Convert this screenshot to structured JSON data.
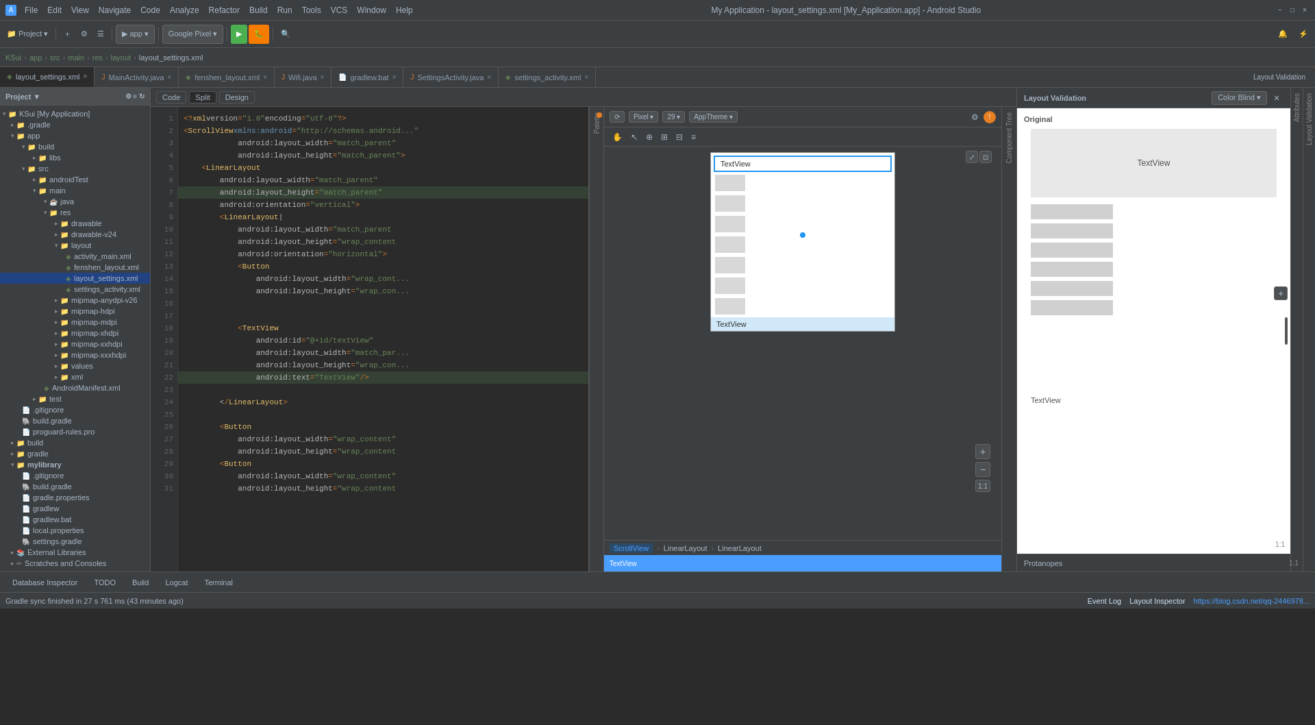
{
  "title_bar": {
    "title": "My Application - layout_settings.xml [My_Application.app] - Android Studio",
    "app_name": "KSui",
    "menus": [
      "File",
      "Edit",
      "View",
      "Navigate",
      "Code",
      "Analyze",
      "Refactor",
      "Build",
      "Run",
      "Tools",
      "VCS",
      "Window",
      "Help"
    ]
  },
  "nav_bar": {
    "items": [
      "KSui",
      "app",
      "src",
      "main",
      "res",
      "layout",
      "layout_settings.xml"
    ]
  },
  "tabs": [
    {
      "label": "layout_settings.xml",
      "active": true,
      "icon": "xml"
    },
    {
      "label": "MainActivity.java",
      "active": false,
      "icon": "java"
    },
    {
      "label": "fenshen_layout.xml",
      "active": false,
      "icon": "xml"
    },
    {
      "label": "Wifi.java",
      "active": false,
      "icon": "java"
    },
    {
      "label": "gradlew.bat",
      "active": false,
      "icon": "bat"
    },
    {
      "label": "SettingsActivity.java",
      "active": false,
      "icon": "java"
    },
    {
      "label": "settings_activity.xml",
      "active": false,
      "icon": "xml"
    }
  ],
  "toolbar": {
    "module_selector": "app",
    "device_selector": "Google Pixel",
    "run_label": "▶",
    "debug_label": "🐛"
  },
  "code_toolbar": {
    "code_label": "Code",
    "split_label": "Split",
    "design_label": "Design"
  },
  "code_lines": [
    {
      "num": 1,
      "text": "<?xml version=\"1.0\" encoding=\"utf-8\"?>"
    },
    {
      "num": 2,
      "text": "<ScrollView xmlns:android=\"http://schemas.android...\""
    },
    {
      "num": 3,
      "text": "            android:layout_width=\"match_parent\""
    },
    {
      "num": 4,
      "text": "            android:layout_height=\"match_parent\">"
    },
    {
      "num": 5,
      "text": "    <LinearLayout"
    },
    {
      "num": 6,
      "text": "        android:layout_width=\"match_parent\""
    },
    {
      "num": 7,
      "text": "        android:layout_height=\"match_parent\""
    },
    {
      "num": 8,
      "text": "        android:orientation=\"vertical\">"
    },
    {
      "num": 9,
      "text": "        <LinearLayout"
    },
    {
      "num": 10,
      "text": "            android:layout_width=\"match_parent\""
    },
    {
      "num": 11,
      "text": "            android:layout_height=\"wrap_content\""
    },
    {
      "num": 12,
      "text": "            android:orientation=\"horizontal\">"
    },
    {
      "num": 13,
      "text": "            <Button"
    },
    {
      "num": 14,
      "text": "                android:layout_width=\"wrap_cont..."
    },
    {
      "num": 15,
      "text": "                android:layout_height=\"wrap_con..."
    },
    {
      "num": 16,
      "text": ""
    },
    {
      "num": 17,
      "text": ""
    },
    {
      "num": 18,
      "text": "            <TextView"
    },
    {
      "num": 19,
      "text": "                android:id=\"@+id/textView\""
    },
    {
      "num": 20,
      "text": "                android:layout_width=\"match_par..."
    },
    {
      "num": 21,
      "text": "                android:layout_height=\"wrap_con..."
    },
    {
      "num": 22,
      "text": "                android:text=\"TextView\" />"
    },
    {
      "num": 23,
      "text": ""
    },
    {
      "num": 24,
      "text": "        <Button"
    },
    {
      "num": 25,
      "text": "            android:layout_width=\"wrap_content\""
    },
    {
      "num": 26,
      "text": "            android:layout_height=\"wrap_content"
    },
    {
      "num": 27,
      "text": "        <Button"
    },
    {
      "num": 28,
      "text": "            android:layout_width=\"wrap_content\""
    },
    {
      "num": 29,
      "text": "            android:layout_height=\"wrap_content"
    },
    {
      "num": 30,
      "text": "        <Button"
    },
    {
      "num": 31,
      "text": "            android:layout_width=\"wrap_cont..."
    }
  ],
  "file_tree": {
    "items": [
      {
        "label": "My Application",
        "type": "project",
        "indent": 0,
        "expanded": true
      },
      {
        "label": ".gradle",
        "type": "folder",
        "indent": 1,
        "expanded": false
      },
      {
        "label": "app",
        "type": "folder",
        "indent": 1,
        "expanded": true
      },
      {
        "label": "build",
        "type": "folder",
        "indent": 2,
        "expanded": true
      },
      {
        "label": "libs",
        "type": "folder",
        "indent": 3,
        "expanded": false
      },
      {
        "label": "src",
        "type": "folder",
        "indent": 2,
        "expanded": true
      },
      {
        "label": "androidTest",
        "type": "folder",
        "indent": 3,
        "expanded": false
      },
      {
        "label": "main",
        "type": "folder",
        "indent": 3,
        "expanded": true
      },
      {
        "label": "java",
        "type": "folder",
        "indent": 4,
        "expanded": true
      },
      {
        "label": "res",
        "type": "folder",
        "indent": 4,
        "expanded": true
      },
      {
        "label": "drawable",
        "type": "folder",
        "indent": 5,
        "expanded": false
      },
      {
        "label": "drawable-v24",
        "type": "folder",
        "indent": 5,
        "expanded": false
      },
      {
        "label": "layout",
        "type": "folder",
        "indent": 5,
        "expanded": true
      },
      {
        "label": "activity_main.xml",
        "type": "xml",
        "indent": 6
      },
      {
        "label": "fenshen_layout.xml",
        "type": "xml",
        "indent": 6
      },
      {
        "label": "layout_settings.xml",
        "type": "xml",
        "indent": 6,
        "selected": true
      },
      {
        "label": "settings_activity.xml",
        "type": "xml",
        "indent": 6
      },
      {
        "label": "mipmap-anydpi-v26",
        "type": "folder",
        "indent": 5,
        "expanded": false
      },
      {
        "label": "mipmap-hdpi",
        "type": "folder",
        "indent": 5,
        "expanded": false
      },
      {
        "label": "mipmap-mdpi",
        "type": "folder",
        "indent": 5,
        "expanded": false
      },
      {
        "label": "mipmap-xhdpi",
        "type": "folder",
        "indent": 5,
        "expanded": false
      },
      {
        "label": "mipmap-xxhdpi",
        "type": "folder",
        "indent": 5,
        "expanded": false
      },
      {
        "label": "mipmap-xxxhdpi",
        "type": "folder",
        "indent": 5,
        "expanded": false
      },
      {
        "label": "values",
        "type": "folder",
        "indent": 5,
        "expanded": false
      },
      {
        "label": "xml",
        "type": "folder",
        "indent": 5,
        "expanded": false
      },
      {
        "label": "AndroidManifest.xml",
        "type": "xml",
        "indent": 4
      },
      {
        "label": "test",
        "type": "folder",
        "indent": 3,
        "expanded": false
      },
      {
        "label": ".gitignore",
        "type": "file",
        "indent": 2
      },
      {
        "label": "build.gradle",
        "type": "gradle",
        "indent": 2
      },
      {
        "label": "proguard-rules.pro",
        "type": "file",
        "indent": 2
      },
      {
        "label": "build",
        "type": "folder",
        "indent": 1,
        "expanded": false
      },
      {
        "label": "gradle",
        "type": "folder",
        "indent": 1,
        "expanded": false
      },
      {
        "label": "mylibrary",
        "type": "folder",
        "indent": 1,
        "expanded": true,
        "bold": true
      },
      {
        "label": ".gitignore",
        "type": "file",
        "indent": 2
      },
      {
        "label": "build.gradle",
        "type": "gradle",
        "indent": 2
      },
      {
        "label": "gradle.properties",
        "type": "props",
        "indent": 2
      },
      {
        "label": "gradlew",
        "type": "file",
        "indent": 2
      },
      {
        "label": "gradlew.bat",
        "type": "file",
        "indent": 2
      },
      {
        "label": "local.properties",
        "type": "props",
        "indent": 2
      },
      {
        "label": "settings.gradle",
        "type": "gradle",
        "indent": 2
      },
      {
        "label": "External Libraries",
        "type": "folder",
        "indent": 1,
        "expanded": false
      },
      {
        "label": "Scratches and Consoles",
        "type": "folder",
        "indent": 1,
        "expanded": false
      }
    ]
  },
  "preview": {
    "selected_widget": "TextView",
    "bottom_caption": "TextView",
    "breadcrumb": [
      "ScrollView",
      "LinearLayout",
      "LinearLayout"
    ]
  },
  "right_panel": {
    "title": "Layout Validation",
    "original_label": "Original",
    "textview_label": "TextView",
    "textview_bottom": "TextView",
    "protanopes_label": "Protanopes",
    "color_blind_selector": "Color Blind"
  },
  "bottom_status": {
    "message": "Gradle sync finished in 27 s 761 ms (43 minutes ago)",
    "right": {
      "event_log": "Event Log",
      "layout_inspector": "Layout Inspector",
      "url": "https://blog.csdn.net/qq-2446978..."
    }
  },
  "tool_windows": [
    {
      "label": "Database Inspector"
    },
    {
      "label": "TODO"
    },
    {
      "label": "Build"
    },
    {
      "label": "Logcat"
    },
    {
      "label": "Terminal"
    }
  ],
  "sidebar_header": "Project ▼",
  "layout_val_close_btn": "×",
  "close_btn": "×",
  "minimize_btn": "−",
  "maximize_btn": "□",
  "zoom_plus": "+",
  "zoom_minus": "−",
  "zoom_ratio": "1:1",
  "right_ratio": "1:1"
}
